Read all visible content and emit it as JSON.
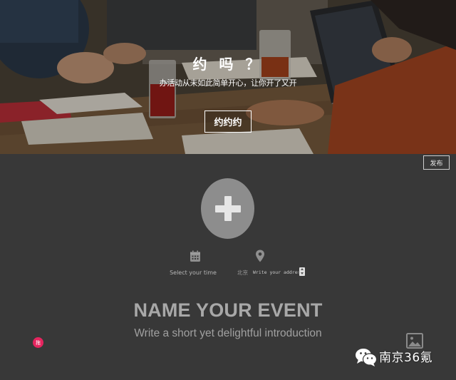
{
  "hero": {
    "title": "约 吗 ？",
    "subtitle": "办活动从未如此简单开心，让你开了又开",
    "cta_label": "约约约"
  },
  "toolbar": {
    "publish_label": "发布"
  },
  "form": {
    "add_photo_icon": "plus-icon",
    "time": {
      "icon": "calendar-icon",
      "label": "Select your time"
    },
    "location": {
      "icon": "map-pin-icon",
      "city": "北京",
      "address_placeholder": "Write your address"
    },
    "event_name_placeholder": "NAME YOUR EVENT",
    "intro_placeholder": "Write a short yet delightful introduction",
    "image_icon": "image-icon"
  },
  "drag_badge": {
    "label": "拖",
    "color": "#e5255f"
  },
  "watermark": {
    "icon": "wechat-icon",
    "text": "南京36氪"
  },
  "colors": {
    "background": "#383838",
    "placeholder_gray": "#a8a8a8",
    "accent_pink": "#e5255f"
  }
}
